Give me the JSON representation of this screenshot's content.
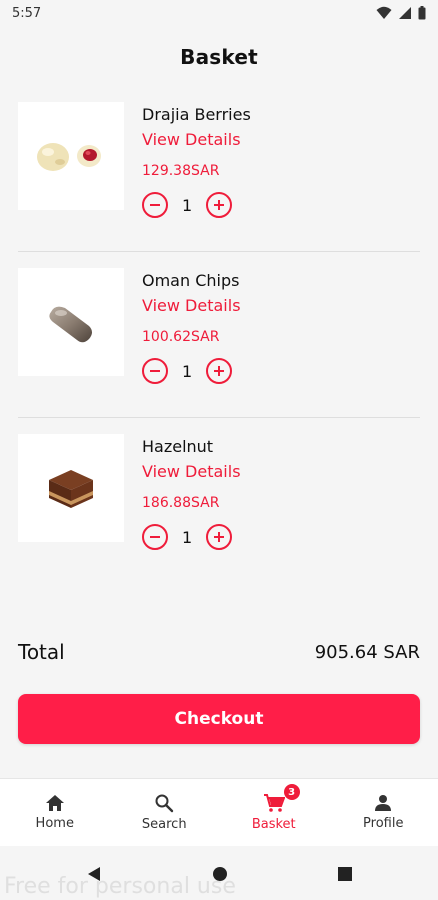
{
  "status_bar": {
    "time": "5:57"
  },
  "header": {
    "title": "Basket"
  },
  "items": [
    {
      "name": "Drajia Berries",
      "view_details": "View Details",
      "price": "129.38SAR",
      "quantity": "1"
    },
    {
      "name": "Oman Chips",
      "view_details": "View Details",
      "price": "100.62SAR",
      "quantity": "1"
    },
    {
      "name": "Hazelnut",
      "view_details": "View Details",
      "price": "186.88SAR",
      "quantity": "1"
    }
  ],
  "summary": {
    "total_label": "Total",
    "total_value": "905.64 SAR"
  },
  "checkout": {
    "label": "Checkout"
  },
  "bottom_nav": {
    "items": [
      {
        "label": "Home",
        "icon": "home-icon"
      },
      {
        "label": "Search",
        "icon": "search-icon"
      },
      {
        "label": "Basket",
        "icon": "cart-icon",
        "badge": "3",
        "active": true
      },
      {
        "label": "Profile",
        "icon": "person-icon"
      }
    ]
  },
  "watermark": "Free for personal use",
  "colors": {
    "accent": "#ef1c3a",
    "checkout": "#ff1e48",
    "background": "#f5f5f5"
  }
}
